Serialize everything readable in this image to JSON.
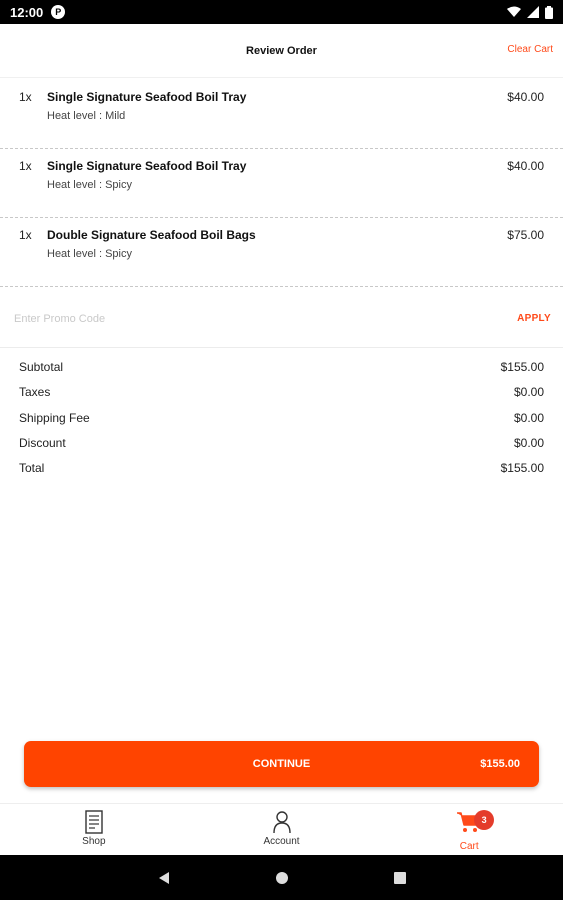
{
  "status_bar": {
    "time": "12:00",
    "notification_glyph": "P"
  },
  "header": {
    "title": "Review Order",
    "clear_label": "Clear Cart"
  },
  "items": [
    {
      "qty": "1x",
      "name": "Single Signature Seafood Boil Tray",
      "detail": "Heat level : Mild",
      "price": "$40.00"
    },
    {
      "qty": "1x",
      "name": "Single Signature Seafood Boil Tray",
      "detail": "Heat level : Spicy",
      "price": "$40.00"
    },
    {
      "qty": "1x",
      "name": "Double Signature Seafood Boil Bags",
      "detail": "Heat level : Spicy",
      "price": "$75.00"
    }
  ],
  "promo": {
    "placeholder": "Enter Promo Code",
    "value": "",
    "apply_label": "APPLY"
  },
  "summary": [
    {
      "label": "Subtotal",
      "value": "$155.00"
    },
    {
      "label": "Taxes",
      "value": "$0.00"
    },
    {
      "label": "Shipping Fee",
      "value": "$0.00"
    },
    {
      "label": "Discount",
      "value": "$0.00"
    },
    {
      "label": "Total",
      "value": "$155.00"
    }
  ],
  "continue": {
    "label": "CONTINUE",
    "amount": "$155.00"
  },
  "bottom_nav": [
    {
      "label": "Shop",
      "icon": "receipt-icon",
      "active": false
    },
    {
      "label": "Account",
      "icon": "person-icon",
      "active": false
    },
    {
      "label": "Cart",
      "icon": "cart-icon",
      "active": true,
      "badge": "3"
    }
  ],
  "colors": {
    "accent": "#ff4400",
    "accent_text": "#ff4a1a",
    "badge": "#e43c2b"
  }
}
